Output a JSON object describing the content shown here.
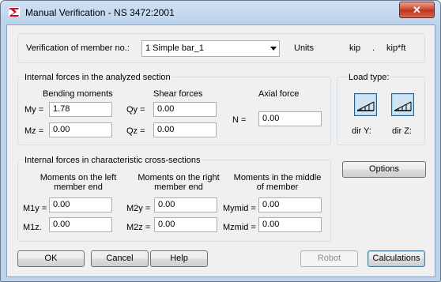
{
  "window": {
    "title": "Manual Verification - NS 3472:2001",
    "close_glyph": "✕"
  },
  "member": {
    "label": "Verification of member no.:",
    "selected": "1 Simple bar_1"
  },
  "units": {
    "label": "Units",
    "force": "kip",
    "separator": ".",
    "moment": "kip*ft"
  },
  "internal_forces": {
    "title": "Internal forces in the analyzed section",
    "bending_header": "Bending moments",
    "shear_header": "Shear forces",
    "axial_header": "Axial force",
    "my_label": "My =",
    "my_value": "1.78",
    "mz_label": "Mz =",
    "mz_value": "0.00",
    "qy_label": "Qy =",
    "qy_value": "0.00",
    "qz_label": "Qz =",
    "qz_value": "0.00",
    "n_label": "N =",
    "n_value": "0.00"
  },
  "load_type": {
    "title": "Load type:",
    "dir_y": "dir Y:",
    "dir_z": "dir Z:"
  },
  "characteristic": {
    "title": "Internal forces in characteristic cross-sections",
    "left_header_1": "Moments on the left",
    "left_header_2": "member end",
    "right_header_1": "Moments on the right",
    "right_header_2": "member end",
    "mid_header_1": "Moments in the middle",
    "mid_header_2": "of member",
    "m1y_label": "M1y =",
    "m1y_value": "0.00",
    "m1z_label": "M1z.",
    "m1z_value": "0.00",
    "m2y_label": "M2y =",
    "m2y_value": "0.00",
    "m2z_label": "M2z =",
    "m2z_value": "0.00",
    "mymid_label": "Mymid =",
    "mymid_value": "0.00",
    "mzmid_label": "Mzmid =",
    "mzmid_value": "0.00"
  },
  "buttons": {
    "options": "Options",
    "ok": "OK",
    "cancel": "Cancel",
    "help": "Help",
    "robot": "Robot",
    "calculations": "Calculations"
  }
}
